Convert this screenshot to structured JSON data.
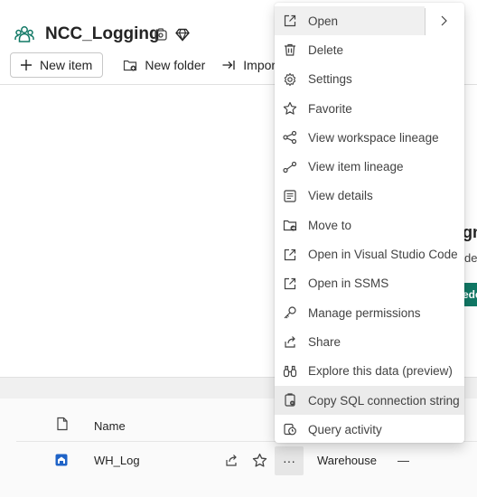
{
  "workspace": {
    "title": "NCC_Logging"
  },
  "toolbar": {
    "new_item": "New item",
    "new_folder": "New folder",
    "import": "Import"
  },
  "background": {
    "peek_heading": "gn",
    "peek_text": "des",
    "peek_button": "ede"
  },
  "list": {
    "header_name": "Name",
    "rows": [
      {
        "name": "WH_Log",
        "more": "···",
        "type": "Warehouse",
        "extra": "—"
      }
    ]
  },
  "context_menu": {
    "items": [
      {
        "label": "Open",
        "icon": "open-external-icon"
      },
      {
        "label": "Delete",
        "icon": "trash-icon"
      },
      {
        "label": "Settings",
        "icon": "gear-icon"
      },
      {
        "label": "Favorite",
        "icon": "star-icon"
      },
      {
        "label": "View workspace lineage",
        "icon": "lineage-icon"
      },
      {
        "label": "View item lineage",
        "icon": "item-lineage-icon"
      },
      {
        "label": "View details",
        "icon": "details-icon"
      },
      {
        "label": "Move to",
        "icon": "folder-move-icon"
      },
      {
        "label": "Open in Visual Studio Code",
        "icon": "open-external-icon"
      },
      {
        "label": "Open in SSMS",
        "icon": "open-external-icon"
      },
      {
        "label": "Manage permissions",
        "icon": "key-icon"
      },
      {
        "label": "Share",
        "icon": "share-icon"
      },
      {
        "label": "Explore this data (preview)",
        "icon": "binoculars-icon"
      },
      {
        "label": "Copy SQL connection string",
        "icon": "copy-connection-icon"
      },
      {
        "label": "Query activity",
        "icon": "query-activity-icon"
      }
    ]
  },
  "colors": {
    "accent_green": "#117865",
    "warehouse_blue": "#1f63c7"
  }
}
